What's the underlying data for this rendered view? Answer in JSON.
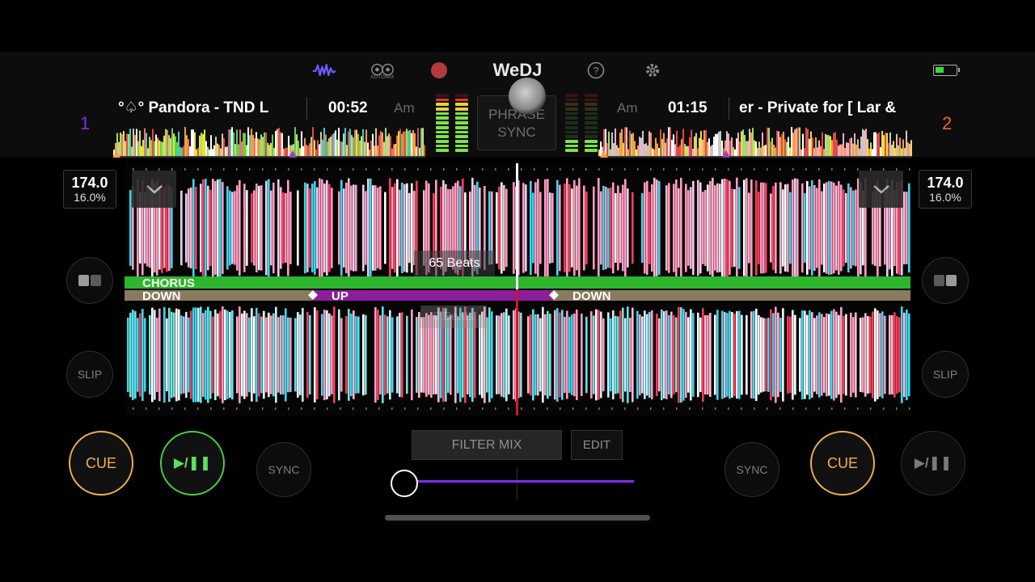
{
  "app": {
    "name": "WeDJ"
  },
  "topbar": {
    "waveform_icon": "waveform-icon",
    "automix_label": "AUTOMIX",
    "record_icon": "record-icon",
    "help_icon": "help-icon",
    "settings_icon": "gear-icon",
    "battery_icon": "battery-icon"
  },
  "deck1": {
    "number": "1",
    "title": "°♤° Pandora - TND L",
    "time": "00:52",
    "key": "Am",
    "bpm": "174.0",
    "pitch": "16.0%",
    "cue_label": "CUE",
    "play_label": "▶/❚❚",
    "sync_label": "SYNC",
    "slip_label": "SLIP"
  },
  "deck2": {
    "number": "2",
    "title": "er - Private for [ Lar &",
    "time": "01:15",
    "key": "Am",
    "bpm": "174.0",
    "pitch": "16.0%",
    "cue_label": "CUE",
    "play_label": "▶/❚❚",
    "sync_label": "SYNC",
    "slip_label": "SLIP"
  },
  "center": {
    "phrase_sync_line1": "PHRASE",
    "phrase_sync_line2": "SYNC",
    "beats_upper": "65 Beats",
    "beats_lower": "8 Beats"
  },
  "phrases": {
    "deck1": [
      "CHORUS"
    ],
    "deck2": [
      "DOWN",
      "UP",
      "DOWN"
    ]
  },
  "mixer": {
    "filter_mix_label": "FILTER MIX",
    "edit_label": "EDIT",
    "crossfader_position": 0.0
  },
  "colors": {
    "deck1_accent": "#8a2be2",
    "deck2_accent": "#ff5a36",
    "cue": "#f0b04c",
    "play_active": "#47cc47",
    "crossfader": "#7d2ff0",
    "chorus_band": "#2db52d",
    "down_band": "#8a7a5e",
    "up_band": "#8c1e9c"
  }
}
